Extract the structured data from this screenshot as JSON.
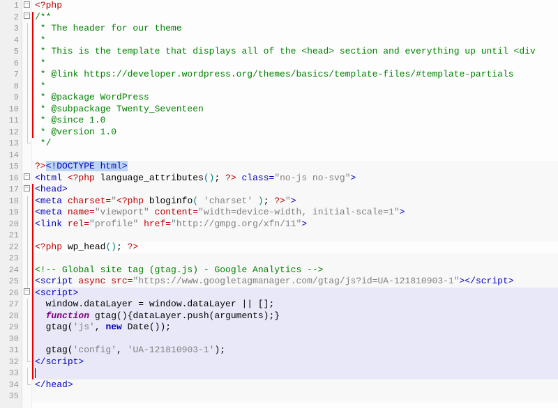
{
  "lines": [
    {
      "n": 1,
      "fold": "box",
      "bar": false,
      "bg": "",
      "segs": [
        {
          "t": "<?php",
          "c": "c-red"
        }
      ]
    },
    {
      "n": 2,
      "fold": "box",
      "bar": true,
      "bg": "",
      "segs": [
        {
          "t": "/**",
          "c": "c-green"
        }
      ]
    },
    {
      "n": 3,
      "fold": "line",
      "bar": true,
      "bg": "",
      "segs": [
        {
          "t": " * The header for our theme",
          "c": "c-green"
        }
      ]
    },
    {
      "n": 4,
      "fold": "line",
      "bar": true,
      "bg": "",
      "segs": [
        {
          "t": " *",
          "c": "c-green"
        }
      ]
    },
    {
      "n": 5,
      "fold": "line",
      "bar": true,
      "bg": "",
      "segs": [
        {
          "t": " * This is the template that displays all of the <head> section and everything up until <div",
          "c": "c-green"
        }
      ]
    },
    {
      "n": 6,
      "fold": "line",
      "bar": true,
      "bg": "",
      "segs": [
        {
          "t": " *",
          "c": "c-green"
        }
      ]
    },
    {
      "n": 7,
      "fold": "line",
      "bar": true,
      "bg": "",
      "segs": [
        {
          "t": " * @link https://developer.wordpress.org/themes/basics/template-files/#template-partials",
          "c": "c-green"
        }
      ]
    },
    {
      "n": 8,
      "fold": "line",
      "bar": true,
      "bg": "",
      "segs": [
        {
          "t": " *",
          "c": "c-green"
        }
      ]
    },
    {
      "n": 9,
      "fold": "line",
      "bar": true,
      "bg": "",
      "segs": [
        {
          "t": " * @package WordPress",
          "c": "c-green"
        }
      ]
    },
    {
      "n": 10,
      "fold": "line",
      "bar": true,
      "bg": "",
      "segs": [
        {
          "t": " * @subpackage Twenty_Seventeen",
          "c": "c-green"
        }
      ]
    },
    {
      "n": 11,
      "fold": "line",
      "bar": true,
      "bg": "",
      "segs": [
        {
          "t": " * @since 1.0",
          "c": "c-green"
        }
      ]
    },
    {
      "n": 12,
      "fold": "line",
      "bar": true,
      "bg": "",
      "segs": [
        {
          "t": " * @version 1.0",
          "c": "c-green"
        }
      ]
    },
    {
      "n": 13,
      "fold": "corner",
      "bar": false,
      "bg": "",
      "segs": [
        {
          "t": " */",
          "c": "c-green"
        }
      ]
    },
    {
      "n": 14,
      "fold": "",
      "bar": false,
      "bg": "",
      "segs": [
        {
          "t": "",
          "c": ""
        }
      ]
    },
    {
      "n": 15,
      "fold": "",
      "bar": false,
      "bg": "bg-alt",
      "segs": [
        {
          "t": "?>",
          "c": "c-red"
        },
        {
          "t": "<!DOCTYPE html>",
          "c": "c-blue",
          "sel": true
        }
      ]
    },
    {
      "n": 16,
      "fold": "box",
      "bar": false,
      "bg": "bg-alt",
      "segs": [
        {
          "t": "<",
          "c": "c-blue"
        },
        {
          "t": "html ",
          "c": "c-blue"
        },
        {
          "t": "<?php",
          "c": "c-red"
        },
        {
          "t": " language_attributes",
          "c": "c-black"
        },
        {
          "t": "()",
          "c": "c-teal"
        },
        {
          "t": "; ",
          "c": "c-black"
        },
        {
          "t": "?>",
          "c": "c-red"
        },
        {
          "t": " class=",
          "c": "c-blue"
        },
        {
          "t": "\"no-js no-svg\"",
          "c": "c-gray"
        },
        {
          "t": ">",
          "c": "c-blue"
        }
      ]
    },
    {
      "n": 17,
      "fold": "box",
      "bar": true,
      "bg": "bg-alt",
      "segs": [
        {
          "t": "<",
          "c": "c-blue"
        },
        {
          "t": "head",
          "c": "c-blue"
        },
        {
          "t": ">",
          "c": "c-blue"
        }
      ]
    },
    {
      "n": 18,
      "fold": "line",
      "bar": true,
      "bg": "bg-alt",
      "segs": [
        {
          "t": "<",
          "c": "c-blue"
        },
        {
          "t": "meta ",
          "c": "c-blue"
        },
        {
          "t": "charset=",
          "c": "c-red"
        },
        {
          "t": "\"",
          "c": "c-gray"
        },
        {
          "t": "<?php",
          "c": "c-red"
        },
        {
          "t": " bloginfo",
          "c": "c-black"
        },
        {
          "t": "( ",
          "c": "c-teal"
        },
        {
          "t": "'charset'",
          "c": "c-gray"
        },
        {
          "t": " )",
          "c": "c-teal"
        },
        {
          "t": "; ",
          "c": "c-black"
        },
        {
          "t": "?>",
          "c": "c-red"
        },
        {
          "t": "\"",
          "c": "c-gray"
        },
        {
          "t": ">",
          "c": "c-blue"
        }
      ]
    },
    {
      "n": 19,
      "fold": "line",
      "bar": true,
      "bg": "bg-alt",
      "segs": [
        {
          "t": "<",
          "c": "c-blue"
        },
        {
          "t": "meta ",
          "c": "c-blue"
        },
        {
          "t": "name=",
          "c": "c-red"
        },
        {
          "t": "\"viewport\" ",
          "c": "c-gray"
        },
        {
          "t": "content=",
          "c": "c-red"
        },
        {
          "t": "\"width=device-width, initial-scale=1\"",
          "c": "c-gray"
        },
        {
          "t": ">",
          "c": "c-blue"
        }
      ]
    },
    {
      "n": 20,
      "fold": "line",
      "bar": true,
      "bg": "bg-alt",
      "segs": [
        {
          "t": "<",
          "c": "c-blue"
        },
        {
          "t": "link ",
          "c": "c-blue"
        },
        {
          "t": "rel=",
          "c": "c-red"
        },
        {
          "t": "\"profile\" ",
          "c": "c-gray"
        },
        {
          "t": "href=",
          "c": "c-red"
        },
        {
          "t": "\"http://gmpg.org/xfn/11\"",
          "c": "c-gray"
        },
        {
          "t": ">",
          "c": "c-blue"
        }
      ]
    },
    {
      "n": 21,
      "fold": "line",
      "bar": true,
      "bg": "bg-alt",
      "segs": [
        {
          "t": "",
          "c": ""
        }
      ]
    },
    {
      "n": 22,
      "fold": "line",
      "bar": true,
      "bg": "",
      "segs": [
        {
          "t": "<?php",
          "c": "c-red"
        },
        {
          "t": " wp_head",
          "c": "c-black"
        },
        {
          "t": "()",
          "c": "c-teal"
        },
        {
          "t": "; ",
          "c": "c-black"
        },
        {
          "t": "?>",
          "c": "c-red"
        }
      ]
    },
    {
      "n": 23,
      "fold": "line",
      "bar": true,
      "bg": "bg-alt",
      "segs": [
        {
          "t": "",
          "c": ""
        }
      ]
    },
    {
      "n": 24,
      "fold": "line",
      "bar": true,
      "bg": "bg-alt",
      "segs": [
        {
          "t": "<!-- Global site tag (gtag.js) - Google Analytics -->",
          "c": "c-green"
        }
      ]
    },
    {
      "n": 25,
      "fold": "line",
      "bar": true,
      "bg": "bg-alt",
      "segs": [
        {
          "t": "<",
          "c": "c-blue"
        },
        {
          "t": "script ",
          "c": "c-blue"
        },
        {
          "t": "async ",
          "c": "c-red"
        },
        {
          "t": "src=",
          "c": "c-red"
        },
        {
          "t": "\"https://www.googletagmanager.com/gtag/js?id=UA-121810903-1\"",
          "c": "c-gray"
        },
        {
          "t": "></",
          "c": "c-blue"
        },
        {
          "t": "script",
          "c": "c-blue"
        },
        {
          "t": ">",
          "c": "c-blue"
        }
      ]
    },
    {
      "n": 26,
      "fold": "box",
      "bar": true,
      "bg": "bg-hl",
      "segs": [
        {
          "t": "<",
          "c": "c-blue"
        },
        {
          "t": "script",
          "c": "c-blue"
        },
        {
          "t": ">",
          "c": "c-blue"
        }
      ]
    },
    {
      "n": 27,
      "fold": "line",
      "bar": true,
      "bg": "bg-hl",
      "segs": [
        {
          "t": "  window.dataLayer = window.dataLayer || [];",
          "c": "c-black"
        }
      ]
    },
    {
      "n": 28,
      "fold": "line",
      "bar": true,
      "bg": "bg-hl",
      "segs": [
        {
          "t": "  ",
          "c": ""
        },
        {
          "t": "function",
          "c": "c-purple bold"
        },
        {
          "t": " gtag(){dataLayer.push(arguments);}",
          "c": "c-black"
        }
      ]
    },
    {
      "n": 29,
      "fold": "line",
      "bar": true,
      "bg": "bg-hl",
      "segs": [
        {
          "t": "  gtag(",
          "c": "c-black"
        },
        {
          "t": "'js'",
          "c": "c-gray"
        },
        {
          "t": ", ",
          "c": "c-black"
        },
        {
          "t": "new",
          "c": "c-blue bold"
        },
        {
          "t": " Date());",
          "c": "c-black"
        }
      ]
    },
    {
      "n": 30,
      "fold": "line",
      "bar": true,
      "bg": "bg-hl",
      "segs": [
        {
          "t": "",
          "c": ""
        }
      ]
    },
    {
      "n": 31,
      "fold": "line",
      "bar": true,
      "bg": "bg-hl",
      "segs": [
        {
          "t": "  gtag(",
          "c": "c-black"
        },
        {
          "t": "'config'",
          "c": "c-gray"
        },
        {
          "t": ", ",
          "c": "c-black"
        },
        {
          "t": "'UA-121810903-1'",
          "c": "c-gray"
        },
        {
          "t": ");",
          "c": "c-black"
        }
      ]
    },
    {
      "n": 32,
      "fold": "corner",
      "bar": true,
      "bg": "bg-hl",
      "segs": [
        {
          "t": "</",
          "c": "c-blue"
        },
        {
          "t": "script",
          "c": "c-blue"
        },
        {
          "t": ">",
          "c": "c-blue"
        }
      ]
    },
    {
      "n": 33,
      "fold": "line",
      "bar": true,
      "bg": "bg-hl",
      "segs": [
        {
          "t": "",
          "c": "",
          "cursor": true
        }
      ]
    },
    {
      "n": 34,
      "fold": "corner",
      "bar": false,
      "bg": "bg-alt",
      "segs": [
        {
          "t": "</",
          "c": "c-blue"
        },
        {
          "t": "head",
          "c": "c-blue"
        },
        {
          "t": ">",
          "c": "c-blue"
        }
      ]
    },
    {
      "n": 35,
      "fold": "",
      "bar": false,
      "bg": "bg-alt",
      "segs": [
        {
          "t": "",
          "c": ""
        }
      ]
    }
  ]
}
